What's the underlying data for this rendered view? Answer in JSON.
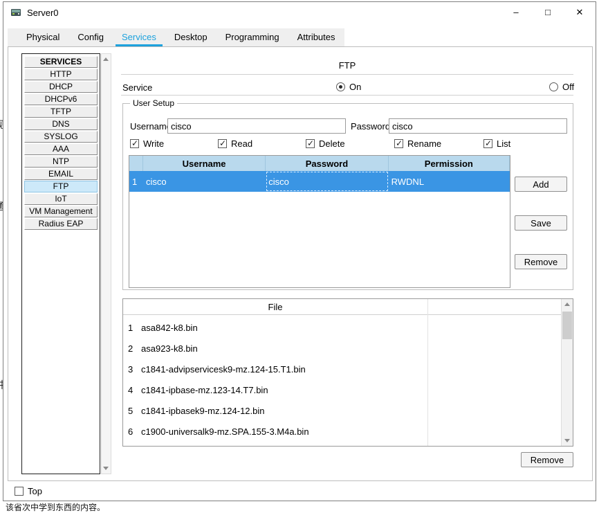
{
  "background": {
    "bottom_text": "该省次中学到东西的内容。",
    "edge_fragments": [
      "视",
      "通",
      "讲"
    ]
  },
  "window": {
    "title": "Server0",
    "minimize_glyph": "–",
    "maximize_glyph": "□",
    "close_glyph": "✕"
  },
  "tabs": [
    "Physical",
    "Config",
    "Services",
    "Desktop",
    "Programming",
    "Attributes"
  ],
  "active_tab": "Services",
  "sidebar": {
    "header": "SERVICES",
    "items": [
      "HTTP",
      "DHCP",
      "DHCPv6",
      "TFTP",
      "DNS",
      "SYSLOG",
      "AAA",
      "NTP",
      "EMAIL",
      "FTP",
      "IoT",
      "VM Management",
      "Radius EAP"
    ],
    "selected_item": "FTP"
  },
  "colors": {
    "active_tab_accent": "#1da2dd",
    "table_header_bg": "#b9d9ed",
    "selected_row_bg": "#3a95e4",
    "selected_sidebar_bg": "#cde9f9"
  },
  "ftp": {
    "title": "FTP",
    "service_label": "Service",
    "on_label": "On",
    "off_label": "Off",
    "service_state": "On",
    "user_setup": {
      "group_title": "User Setup",
      "username_label": "Username",
      "username_value": "cisco",
      "password_label": "Password",
      "password_value": "cisco",
      "permissions": [
        "Write",
        "Read",
        "Delete",
        "Rename",
        "List"
      ],
      "permissions_checked": [
        true,
        true,
        true,
        true,
        true
      ],
      "table_headers": [
        "Username",
        "Password",
        "Permission"
      ],
      "rows": [
        {
          "num": "1",
          "username": "cisco",
          "password": "cisco",
          "permission": "RWDNL",
          "selected": true
        }
      ],
      "add_label": "Add",
      "save_label": "Save",
      "remove_label": "Remove"
    },
    "file_list": {
      "header": "File",
      "files": [
        {
          "num": "1",
          "name": "asa842-k8.bin"
        },
        {
          "num": "2",
          "name": "asa923-k8.bin"
        },
        {
          "num": "3",
          "name": "c1841-advipservicesk9-mz.124-15.T1.bin"
        },
        {
          "num": "4",
          "name": "c1841-ipbase-mz.123-14.T7.bin"
        },
        {
          "num": "5",
          "name": "c1841-ipbasek9-mz.124-12.bin"
        },
        {
          "num": "6",
          "name": "c1900-universalk9-mz.SPA.155-3.M4a.bin"
        }
      ],
      "remove_label": "Remove"
    }
  },
  "footer": {
    "top_label": "Top"
  }
}
